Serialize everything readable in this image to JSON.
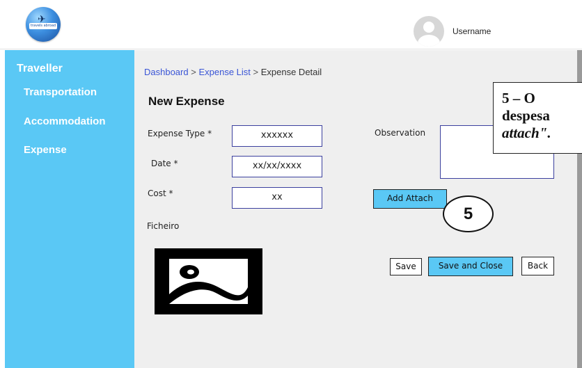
{
  "header": {
    "logo_text": "travels abroad",
    "username": "Username"
  },
  "sidebar": {
    "title": "Traveller",
    "items": [
      {
        "label": "Transportation"
      },
      {
        "label": "Accommodation"
      },
      {
        "label": "Expense"
      }
    ]
  },
  "breadcrumb": {
    "items": [
      "Dashboard",
      "Expense List",
      "Expense Detail"
    ],
    "separator": ">"
  },
  "form": {
    "title": "New Expense",
    "expense_type": {
      "label": "Expense Type *",
      "value": "xxxxxx"
    },
    "date": {
      "label": "Date *",
      "value": "xx/xx/xxxx"
    },
    "cost": {
      "label": "Cost *",
      "value": "xx"
    },
    "observation": {
      "label": "Observation",
      "value": ""
    },
    "file_label": "Ficheiro",
    "add_attach_label": "Add Attach",
    "save_label": "Save",
    "save_close_label": "Save and Close",
    "back_label": "Back"
  },
  "annotation": {
    "badge": "5",
    "line1": "5 – O",
    "line2": "despesa",
    "line3": "attach\"."
  },
  "colors": {
    "sidebar": "#5ac8f5",
    "main_bg": "#efefef",
    "field_border": "#3b3f9e",
    "link": "#3a55d6"
  },
  "icons": [
    "logo-icon",
    "user-avatar-icon",
    "image-placeholder-icon"
  ]
}
